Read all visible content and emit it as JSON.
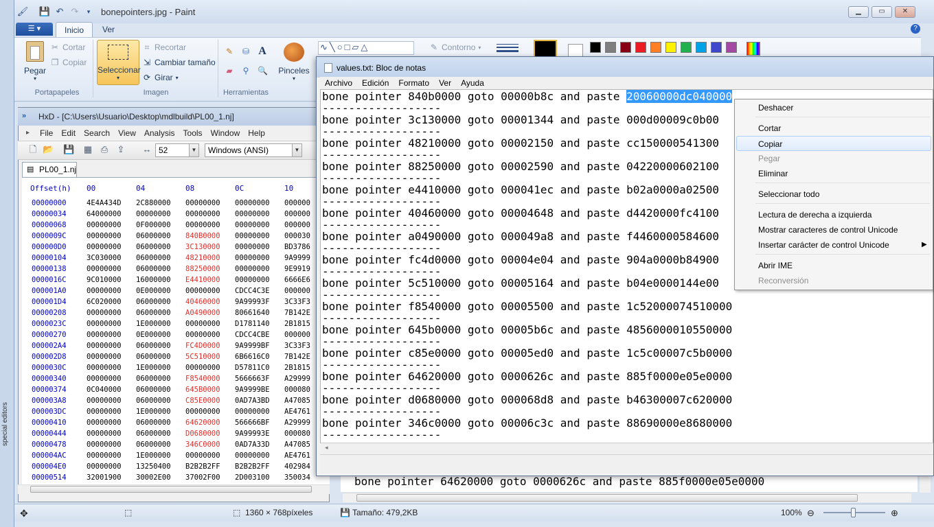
{
  "paint": {
    "title": "bonepointers.jpg - Paint",
    "tabs": [
      "Inicio",
      "Ver"
    ],
    "clipboard": {
      "paste": "Pegar",
      "cut": "Cortar",
      "copy": "Copiar",
      "group": "Portapapeles"
    },
    "image": {
      "select": "Seleccionar",
      "crop": "Recortar",
      "resize": "Cambiar tamaño",
      "rotate": "Girar",
      "group": "Imagen"
    },
    "tools": {
      "group": "Herramientas",
      "brushes": "Pinceles"
    },
    "shapes": {
      "outline": "Contorno"
    },
    "colors": [
      "#000000",
      "#7f7f7f",
      "#880015",
      "#ed1c24",
      "#ff7f27",
      "#fff200",
      "#22b14c",
      "#00a2e8",
      "#3f48cc",
      "#a349a4"
    ],
    "status": {
      "size": "1360 × 768píxeles",
      "filesize": "Tamaño: 479,2KB",
      "zoom": "100%"
    },
    "bg_line": "bone pointer 64620000 goto 0000626c and paste 885f0000e05e0000"
  },
  "hxd": {
    "title": "HxD - [C:\\Users\\Usuario\\Desktop\\mdlbuild\\PL00_1.nj]",
    "menu": [
      "File",
      "Edit",
      "Search",
      "View",
      "Analysis",
      "Tools",
      "Window",
      "Help"
    ],
    "bytes_per_row": "52",
    "charset": "Windows (ANSI)",
    "tab": "PL00_1.nj",
    "header": {
      "offset": "Offset(h)",
      "cols": [
        "00",
        "04",
        "08",
        "0C",
        "10"
      ]
    },
    "rows": [
      {
        "off": "00000000",
        "c": [
          "4E4A434D",
          "2C880000",
          "00000000",
          "00000000",
          "000000"
        ],
        "red": false
      },
      {
        "off": "00000034",
        "c": [
          "64000000",
          "00000000",
          "00000000",
          "00000000",
          "000000"
        ],
        "red": false
      },
      {
        "off": "00000068",
        "c": [
          "00000000",
          "0F000000",
          "00000000",
          "00000000",
          "000000"
        ],
        "red": false
      },
      {
        "off": "0000009C",
        "c": [
          "00000000",
          "06000000",
          "840B0000",
          "00000000",
          "000030"
        ],
        "red": true
      },
      {
        "off": "000000D0",
        "c": [
          "00000000",
          "06000000",
          "3C130000",
          "00000000",
          "BD3786"
        ],
        "red": true
      },
      {
        "off": "00000104",
        "c": [
          "3C030000",
          "06000000",
          "48210000",
          "00000000",
          "9A9999"
        ],
        "red": true
      },
      {
        "off": "00000138",
        "c": [
          "00000000",
          "06000000",
          "88250000",
          "00000000",
          "9E9919"
        ],
        "red": true
      },
      {
        "off": "0000016C",
        "c": [
          "9C010000",
          "16000000",
          "E4410000",
          "00000000",
          "6666E6"
        ],
        "red": true
      },
      {
        "off": "000001A0",
        "c": [
          "00000000",
          "0E000000",
          "00000000",
          "CDCC4C3E",
          "000000"
        ],
        "red": false
      },
      {
        "off": "000001D4",
        "c": [
          "6C020000",
          "06000000",
          "40460000",
          "9A99993F",
          "3C33F3"
        ],
        "red": true
      },
      {
        "off": "00000208",
        "c": [
          "00000000",
          "06000000",
          "A0490000",
          "80661640",
          "7B142E"
        ],
        "red": true
      },
      {
        "off": "0000023C",
        "c": [
          "00000000",
          "1E000000",
          "00000000",
          "D1781140",
          "2B1815"
        ],
        "red": false
      },
      {
        "off": "00000270",
        "c": [
          "00000000",
          "0E000000",
          "00000000",
          "CDCC4CBE",
          "000000"
        ],
        "red": false
      },
      {
        "off": "000002A4",
        "c": [
          "00000000",
          "06000000",
          "FC4D0000",
          "9A9999BF",
          "3C33F3"
        ],
        "red": true
      },
      {
        "off": "000002D8",
        "c": [
          "00000000",
          "06000000",
          "5C510000",
          "6B6616C0",
          "7B142E"
        ],
        "red": true
      },
      {
        "off": "0000030C",
        "c": [
          "00000000",
          "1E000000",
          "00000000",
          "D57811C0",
          "2B1815"
        ],
        "red": false
      },
      {
        "off": "00000340",
        "c": [
          "00000000",
          "06000000",
          "F8540000",
          "5666663F",
          "A29999"
        ],
        "red": true
      },
      {
        "off": "00000374",
        "c": [
          "0C040000",
          "06000000",
          "645B0000",
          "9A9999BE",
          "000080"
        ],
        "red": true
      },
      {
        "off": "000003A8",
        "c": [
          "00000000",
          "06000000",
          "C85E0000",
          "0AD7A3BD",
          "A47085"
        ],
        "red": true
      },
      {
        "off": "000003DC",
        "c": [
          "00000000",
          "1E000000",
          "00000000",
          "00000000",
          "AE4761"
        ],
        "red": false
      },
      {
        "off": "00000410",
        "c": [
          "00000000",
          "06000000",
          "64620000",
          "566666BF",
          "A29999"
        ],
        "red": true
      },
      {
        "off": "00000444",
        "c": [
          "00000000",
          "06000000",
          "D0680000",
          "9A99993E",
          "000080"
        ],
        "red": true
      },
      {
        "off": "00000478",
        "c": [
          "00000000",
          "06000000",
          "346C0000",
          "0AD7A33D",
          "A47085"
        ],
        "red": true
      },
      {
        "off": "000004AC",
        "c": [
          "00000000",
          "1E000000",
          "00000000",
          "00000000",
          "AE4761"
        ],
        "red": false
      },
      {
        "off": "000004E0",
        "c": [
          "00000000",
          "13250400",
          "B2B2B2FF",
          "B2B2B2FF",
          "402984"
        ],
        "red": false
      },
      {
        "off": "00000514",
        "c": [
          "32001900",
          "30002E00",
          "37002F00",
          "2D003100",
          "350034"
        ],
        "red": false
      }
    ]
  },
  "desktop": {
    "sliver": "special editors"
  },
  "notepad": {
    "title": "values.txt: Bloc de notas",
    "menu": [
      "Archivo",
      "Edición",
      "Formato",
      "Ver",
      "Ayuda"
    ],
    "lines": [
      {
        "pre": "bone pointer 840b0000 goto 00000b8c and paste ",
        "sel": "20060000dc040000"
      },
      {
        "pre": "bone pointer 3c130000 goto 00001344 and paste 000d00009c0b00",
        "sel": ""
      },
      {
        "pre": "bone pointer 48210000 goto 00002150 and paste cc150000541300",
        "sel": ""
      },
      {
        "pre": "bone pointer 88250000 goto 00002590 and paste 04220000602100",
        "sel": ""
      },
      {
        "pre": "bone pointer e4410000 goto 000041ec and paste b02a0000a02500",
        "sel": ""
      },
      {
        "pre": "bone pointer 40460000 goto 00004648 and paste d4420000fc4100",
        "sel": ""
      },
      {
        "pre": "bone pointer a0490000 goto 000049a8 and paste f4460000584600",
        "sel": ""
      },
      {
        "pre": "bone pointer fc4d0000 goto 00004e04 and paste 904a0000b84900",
        "sel": ""
      },
      {
        "pre": "bone pointer 5c510000 goto 00005164 and paste b04e0000144e00",
        "sel": ""
      },
      {
        "pre": "bone pointer f8540000 goto 00005500 and paste 1c52000074510000",
        "sel": ""
      },
      {
        "pre": "bone pointer 645b0000 goto 00005b6c and paste 4856000010550000",
        "sel": ""
      },
      {
        "pre": "bone pointer c85e0000 goto 00005ed0 and paste 1c5c00007c5b0000",
        "sel": ""
      },
      {
        "pre": "bone pointer 64620000 goto 0000626c and paste 885f0000e05e0000",
        "sel": ""
      },
      {
        "pre": "bone pointer d0680000 goto 000068d8 and paste b46300007c620000",
        "sel": ""
      },
      {
        "pre": "bone pointer 346c0000 goto 00006c3c and paste 88690000e8680000",
        "sel": ""
      }
    ],
    "dash": "------------------"
  },
  "context_menu": {
    "items": [
      {
        "label": "Deshacer",
        "disabled": false
      },
      {
        "label": "Cortar",
        "disabled": false
      },
      {
        "label": "Copiar",
        "disabled": false,
        "highlight": true
      },
      {
        "label": "Pegar",
        "disabled": true
      },
      {
        "label": "Eliminar",
        "disabled": false
      },
      {
        "label": "Seleccionar todo",
        "disabled": false
      },
      {
        "label": "Lectura de derecha a izquierda",
        "disabled": false
      },
      {
        "label": "Mostrar caracteres de control Unicode",
        "disabled": false
      },
      {
        "label": "Insertar carácter de control Unicode",
        "disabled": false,
        "submenu": true
      },
      {
        "label": "Abrir IME",
        "disabled": false
      },
      {
        "label": "Reconversión",
        "disabled": true
      }
    ]
  }
}
